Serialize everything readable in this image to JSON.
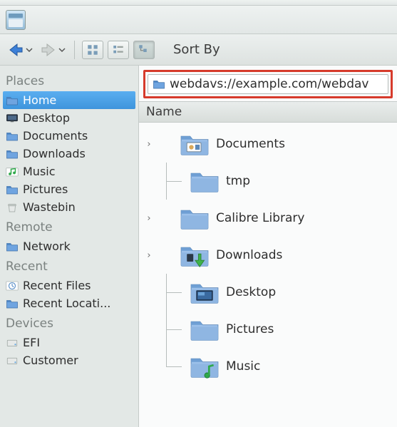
{
  "toolbar": {
    "sort_label": "Sort By"
  },
  "address": {
    "url": "webdavs://example.com/webdav"
  },
  "columns": {
    "name": "Name"
  },
  "sidebar": {
    "sections": [
      {
        "header": "Places",
        "items": [
          {
            "label": "Home",
            "icon": "folder-blue",
            "selected": true
          },
          {
            "label": "Desktop",
            "icon": "monitor",
            "selected": false
          },
          {
            "label": "Documents",
            "icon": "folder-blue",
            "selected": false
          },
          {
            "label": "Downloads",
            "icon": "folder-blue",
            "selected": false
          },
          {
            "label": "Music",
            "icon": "music",
            "selected": false
          },
          {
            "label": "Pictures",
            "icon": "folder-blue",
            "selected": false
          },
          {
            "label": "Wastebin",
            "icon": "trash",
            "selected": false
          }
        ]
      },
      {
        "header": "Remote",
        "items": [
          {
            "label": "Network",
            "icon": "folder-blue",
            "selected": false
          }
        ]
      },
      {
        "header": "Recent",
        "items": [
          {
            "label": "Recent Files",
            "icon": "clock",
            "selected": false
          },
          {
            "label": "Recent Locati...",
            "icon": "folder-blue",
            "selected": false
          }
        ]
      },
      {
        "header": "Devices",
        "items": [
          {
            "label": "EFI",
            "icon": "disk",
            "selected": false
          },
          {
            "label": "Customer",
            "icon": "disk",
            "selected": false
          }
        ]
      }
    ]
  },
  "tree": [
    {
      "label": "Documents",
      "expandable": true,
      "icon": "folder-docs"
    },
    {
      "label": "tmp",
      "expandable": false,
      "icon": "folder"
    },
    {
      "label": "Calibre Library",
      "expandable": true,
      "icon": "folder"
    },
    {
      "label": "Downloads",
      "expandable": true,
      "icon": "folder-download"
    },
    {
      "label": "Desktop",
      "expandable": false,
      "icon": "folder-desktop"
    },
    {
      "label": "Pictures",
      "expandable": false,
      "icon": "folder"
    },
    {
      "label": "Music",
      "expandable": false,
      "icon": "folder-music"
    }
  ]
}
